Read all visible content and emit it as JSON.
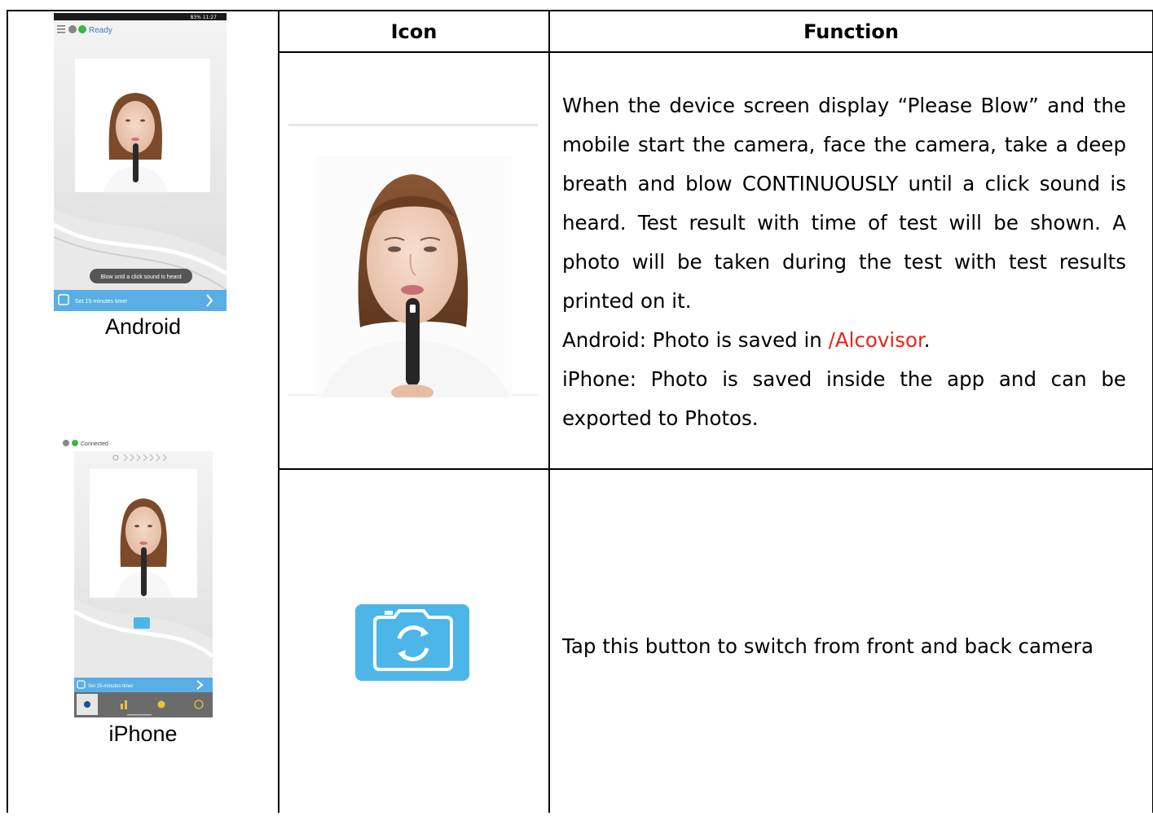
{
  "table": {
    "headers": {
      "icon": "Icon",
      "function": "Function"
    }
  },
  "android": {
    "label": "Android",
    "status_bar": "83% 11:27",
    "status_text": "Ready",
    "toast": "Blow until a click sound is heard",
    "timer_text": "Set 15-minutes timer"
  },
  "iphone": {
    "label": "iPhone",
    "status_text": "Connected",
    "timer_text": "Set 15-minutes timer"
  },
  "rows": [
    {
      "icon": "blow-photo",
      "paragraph": "When the device screen display “Please Blow” and the mobile start the camera, face the camera, take a deep breath and blow CONTINUOUSLY until a click sound is heard.   Test result with time of test will be shown.   A photo will be taken during the test with test results printed on it.",
      "android_prefix": "Android: Photo is saved in ",
      "android_path": "/Alcovisor",
      "android_suffix": ".",
      "iphone_line": "iPhone: Photo is saved inside the app and can be exported to Photos."
    },
    {
      "icon": "switch-camera-icon",
      "text": "Tap this button to switch from front and back camera"
    }
  ],
  "colors": {
    "accent_red": "#e8231c",
    "camera_blue": "#4db6e8",
    "timer_bar": "#5aaee6"
  }
}
